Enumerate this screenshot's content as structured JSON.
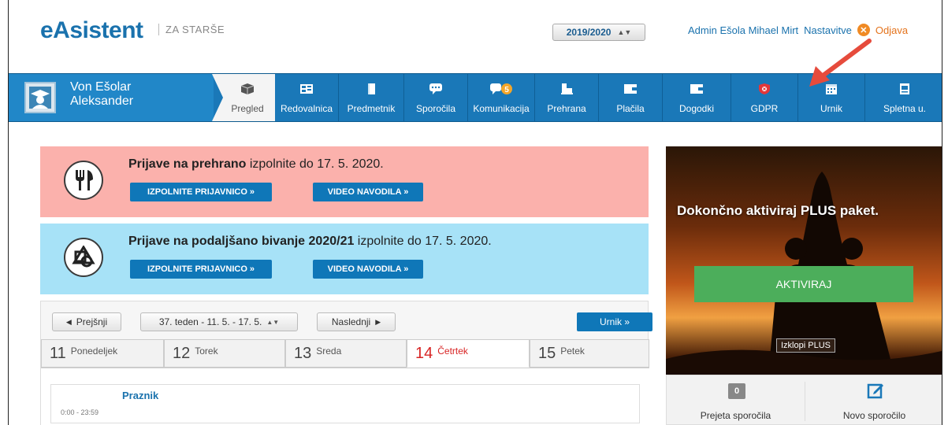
{
  "header": {
    "logo": "eAsistent",
    "logo_sub": "ZA STARŠE",
    "school_year": "2019/2020",
    "user_link": "Admin Ešola Mihael Mirt",
    "settings_link": "Nastavitve",
    "logout_link": "Odjava"
  },
  "user": {
    "first_line": "Von Ešolar",
    "second_line": "Aleksander"
  },
  "nav": {
    "items": [
      {
        "label": "Pregled",
        "icon": "box-icon"
      },
      {
        "label": "Redovalnica",
        "icon": "gradebook-icon"
      },
      {
        "label": "Predmetnik",
        "icon": "book-icon"
      },
      {
        "label": "Sporočila",
        "icon": "chat-icon"
      },
      {
        "label": "Komunikacija",
        "icon": "communication-icon",
        "badge": "5"
      },
      {
        "label": "Prehrana",
        "icon": "food-icon"
      },
      {
        "label": "Plačila",
        "icon": "wallet-icon"
      },
      {
        "label": "Dogodki",
        "icon": "calendar-card-icon"
      },
      {
        "label": "GDPR",
        "icon": "shield-icon"
      },
      {
        "label": "Urnik",
        "icon": "calendar-icon"
      },
      {
        "label": "Spletna u.",
        "icon": "web-icon"
      }
    ]
  },
  "banners": {
    "food": {
      "title_bold": "Prijave na prehrano",
      "title_rest": " izpolnite do 17. 5. 2020.",
      "btn_apply": "IZPOLNITE PRIJAVNICO »",
      "btn_video": "VIDEO NAVODILA »"
    },
    "extended": {
      "title_bold": "Prijave na podaljšano bivanje 2020/21",
      "title_rest": " izpolnite do 17. 5. 2020.",
      "btn_apply": "IZPOLNITE PRIJAVNICO »",
      "btn_video": "VIDEO NAVODILA »"
    }
  },
  "calendar": {
    "prev": "Prejšnji",
    "week": "37. teden - 11. 5. - 17. 5.",
    "next": "Naslednji",
    "urnik_btn": "Urnik »",
    "days": [
      {
        "num": "11",
        "name": "Ponedeljek"
      },
      {
        "num": "12",
        "name": "Torek"
      },
      {
        "num": "13",
        "name": "Sreda"
      },
      {
        "num": "14",
        "name": "Četrtek"
      },
      {
        "num": "15",
        "name": "Petek"
      }
    ],
    "event": {
      "time": "0:00 - 23:59",
      "name": "Praznik"
    }
  },
  "promo": {
    "title": "Dokončno aktiviraj PLUS paket.",
    "activate": "AKTIVIRAJ",
    "disable": "Izklopi PLUS"
  },
  "messages": {
    "received_count": "0",
    "received_label": "Prejeta sporočila",
    "new_label": "Novo sporočilo"
  },
  "colors": {
    "brand": "#1a78b8",
    "alert": "#e64b3c",
    "accent_green": "#4cae5b"
  }
}
